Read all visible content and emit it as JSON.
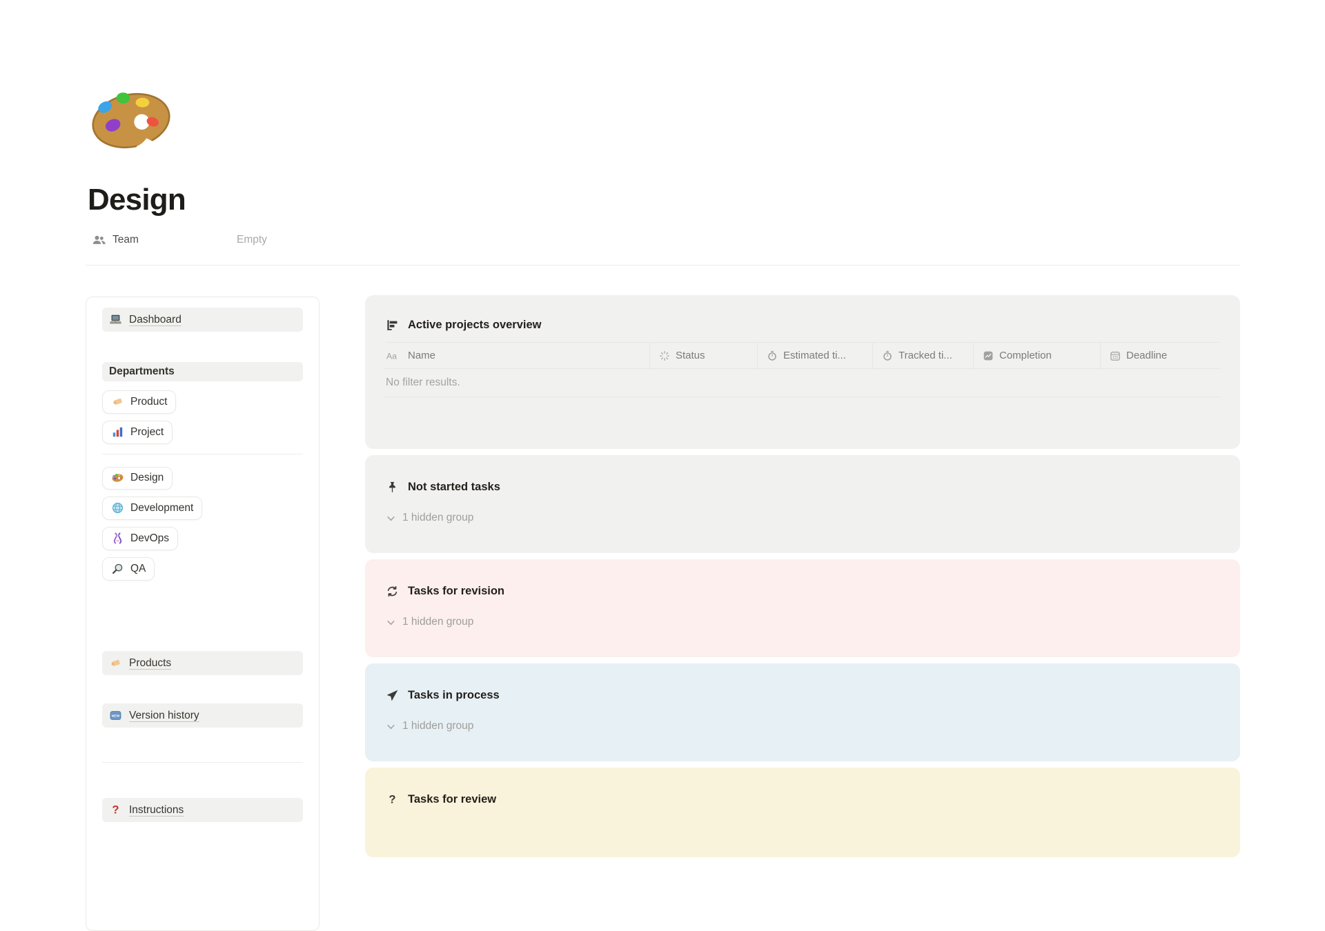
{
  "page": {
    "title": "Design",
    "icon": "palette"
  },
  "properties": {
    "team": {
      "icon": "people",
      "label": "Team",
      "value": "Empty"
    }
  },
  "sidebar": {
    "items": [
      {
        "type": "link",
        "icon": "laptop",
        "label": "Dashboard"
      },
      {
        "type": "heading",
        "label": "Departments"
      },
      {
        "type": "button",
        "icon": "tag",
        "label": "Product"
      },
      {
        "type": "button",
        "icon": "bar-chart",
        "label": "Project"
      },
      {
        "type": "divider"
      },
      {
        "type": "button",
        "icon": "palette-small",
        "label": "Design"
      },
      {
        "type": "button",
        "icon": "globe",
        "label": "Development"
      },
      {
        "type": "button",
        "icon": "dna",
        "label": "DevOps"
      },
      {
        "type": "button",
        "icon": "magnifier",
        "label": "QA"
      },
      {
        "type": "link",
        "icon": "tag",
        "label": "Products"
      },
      {
        "type": "link",
        "icon": "new-badge",
        "label": "Version history"
      },
      {
        "type": "divider"
      },
      {
        "type": "link",
        "icon": "question-red",
        "label": "Instructions"
      }
    ]
  },
  "projects_card": {
    "icon": "bar-chart-horizontal",
    "title": "Active projects overview",
    "bg": "#f1f1ef",
    "columns": [
      {
        "icon": "aa",
        "label": "Name"
      },
      {
        "icon": "status-spinner",
        "label": "Status"
      },
      {
        "icon": "timer",
        "label": "Estimated ti..."
      },
      {
        "icon": "timer",
        "label": "Tracked ti..."
      },
      {
        "icon": "chart",
        "label": "Completion"
      },
      {
        "icon": "calendar",
        "label": "Deadline"
      }
    ],
    "empty_message": "No filter results."
  },
  "task_sections": [
    {
      "id": "not-started",
      "icon": "pin",
      "title": "Not started tasks",
      "hidden_group": "1 hidden group",
      "bg": "#f1f1ef"
    },
    {
      "id": "revision",
      "icon": "refresh",
      "title": "Tasks for revision",
      "hidden_group": "1 hidden group",
      "bg": "#fcefee"
    },
    {
      "id": "in-process",
      "icon": "navigation",
      "title": "Tasks in process",
      "hidden_group": "1 hidden group",
      "bg": "#e7f0f4"
    },
    {
      "id": "review",
      "icon": "question-dark",
      "title": "Tasks for review",
      "hidden_group": null,
      "bg": "#faf3db"
    }
  ]
}
